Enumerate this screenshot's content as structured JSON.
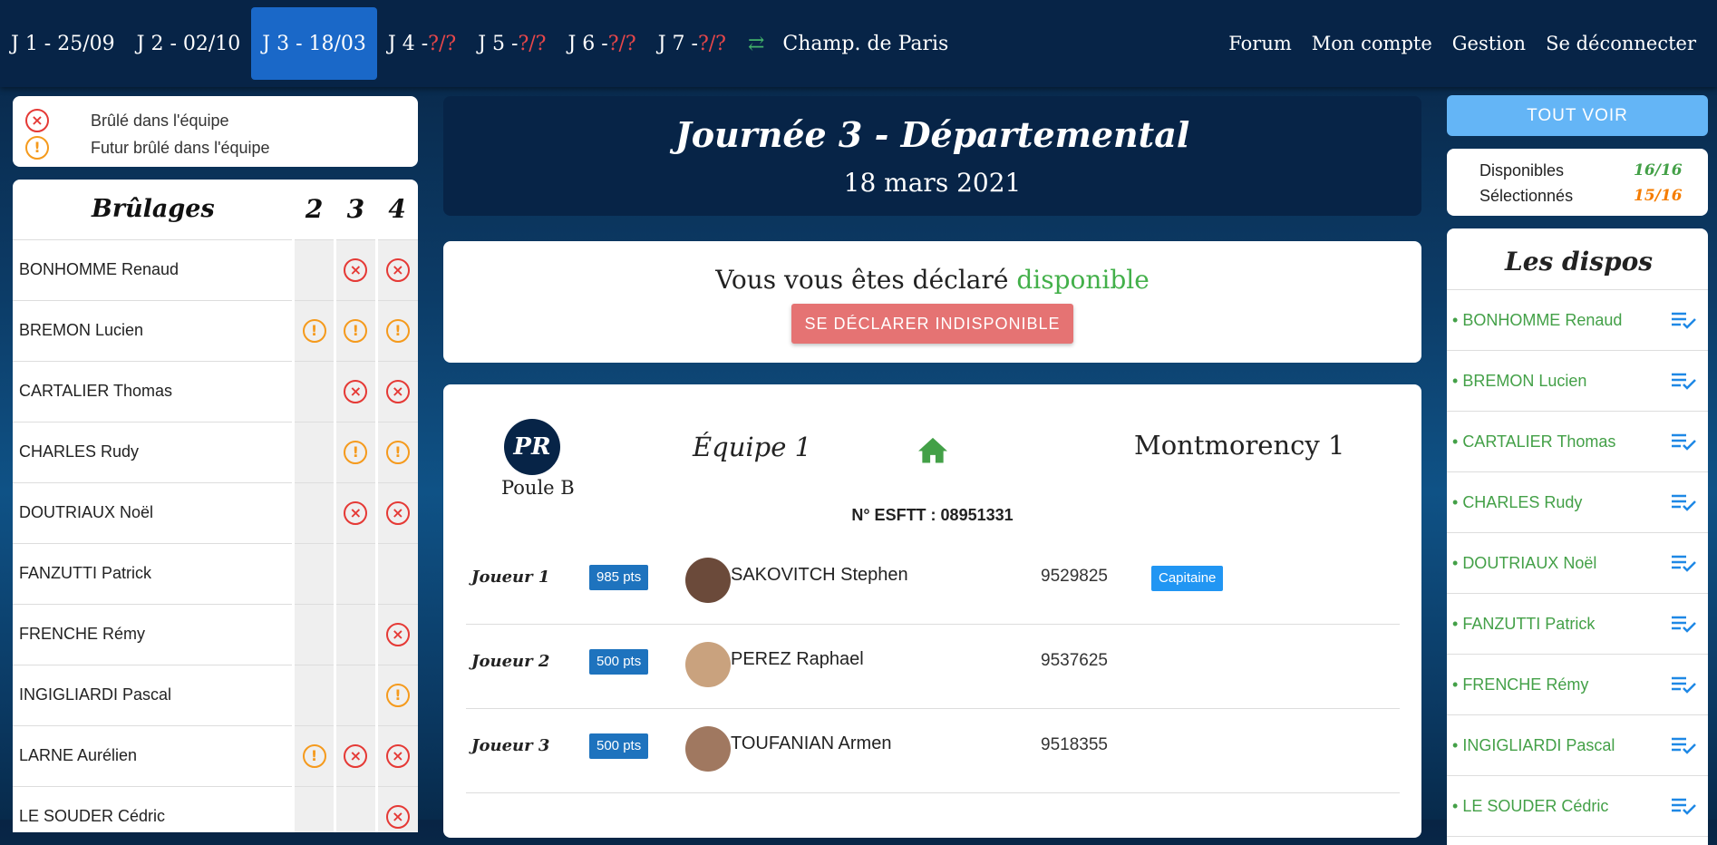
{
  "nav": {
    "days": [
      {
        "label": "J 1 - 25/09",
        "unknown": ""
      },
      {
        "label": "J 2 - 02/10",
        "unknown": ""
      },
      {
        "label": "J 3 - 18/03",
        "unknown": ""
      },
      {
        "label": "J 4 - ",
        "unknown": "?/?"
      },
      {
        "label": "J 5 - ",
        "unknown": "?/?"
      },
      {
        "label": "J 6 - ",
        "unknown": "?/?"
      },
      {
        "label": "J 7 - ",
        "unknown": "?/?"
      }
    ],
    "champ": "Champ. de Paris",
    "right": [
      "Forum",
      "Mon compte",
      "Gestion",
      "Se déconnecter"
    ]
  },
  "legend": {
    "burned": "Brûlé dans l'équipe",
    "future": "Futur brûlé dans l'équipe"
  },
  "brulages": {
    "title": "Brûlages",
    "cols": [
      "2",
      "3",
      "4"
    ],
    "rows": [
      {
        "name": "BONHOMME Renaud",
        "c": [
          "",
          "x",
          "x"
        ]
      },
      {
        "name": "BREMON Lucien",
        "c": [
          "w",
          "w",
          "w"
        ]
      },
      {
        "name": "CARTALIER Thomas",
        "c": [
          "",
          "x",
          "x"
        ]
      },
      {
        "name": "CHARLES Rudy",
        "c": [
          "",
          "w",
          "w"
        ]
      },
      {
        "name": "DOUTRIAUX Noël",
        "c": [
          "",
          "x",
          "x"
        ]
      },
      {
        "name": "FANZUTTI Patrick",
        "c": [
          "",
          "",
          ""
        ]
      },
      {
        "name": "FRENCHE Rémy",
        "c": [
          "",
          "",
          "x"
        ]
      },
      {
        "name": "INGIGLIARDI Pascal",
        "c": [
          "",
          "",
          "w"
        ]
      },
      {
        "name": "LARNE Aurélien",
        "c": [
          "w",
          "x",
          "x"
        ]
      },
      {
        "name": "LE SOUDER Cédric",
        "c": [
          "",
          "",
          "x"
        ]
      }
    ]
  },
  "hero": {
    "title": "Journée 3 - Départemental",
    "date": "18 mars 2021"
  },
  "availability": {
    "prefix": "Vous vous êtes déclaré",
    "status": "disponible",
    "button": "SE DÉCLARER INDISPONIBLE"
  },
  "team": {
    "badge": "PR",
    "poule": "Poule B",
    "equipe": "Équipe 1",
    "opponent": "Montmorency 1",
    "esftt": "N° ESFTT : 08951331",
    "players": [
      {
        "slot": "Joueur 1",
        "pts": "985 pts",
        "name": "SAKOVITCH Stephen",
        "licence": "9529825",
        "badge": "Capitaine"
      },
      {
        "slot": "Joueur 2",
        "pts": "500 pts",
        "name": "PEREZ Raphael",
        "licence": "9537625",
        "badge": ""
      },
      {
        "slot": "Joueur 3",
        "pts": "500 pts",
        "name": "TOUFANIAN Armen",
        "licence": "9518355",
        "badge": ""
      }
    ]
  },
  "sidebar": {
    "see_all": "TOUT VOIR",
    "stats": [
      {
        "label": "Disponibles",
        "value": "16/16",
        "color": "#43a047"
      },
      {
        "label": "Sélectionnés",
        "value": "15/16",
        "color": "#f57c00"
      }
    ],
    "dispos_title": "Les dispos",
    "dispos": [
      "BONHOMME Renaud",
      "BREMON Lucien",
      "CARTALIER Thomas",
      "CHARLES Rudy",
      "DOUTRIAUX Noël",
      "FANZUTTI Patrick",
      "FRENCHE Rémy",
      "INGIGLIARDI Pascal",
      "LE SOUDER Cédric"
    ]
  }
}
